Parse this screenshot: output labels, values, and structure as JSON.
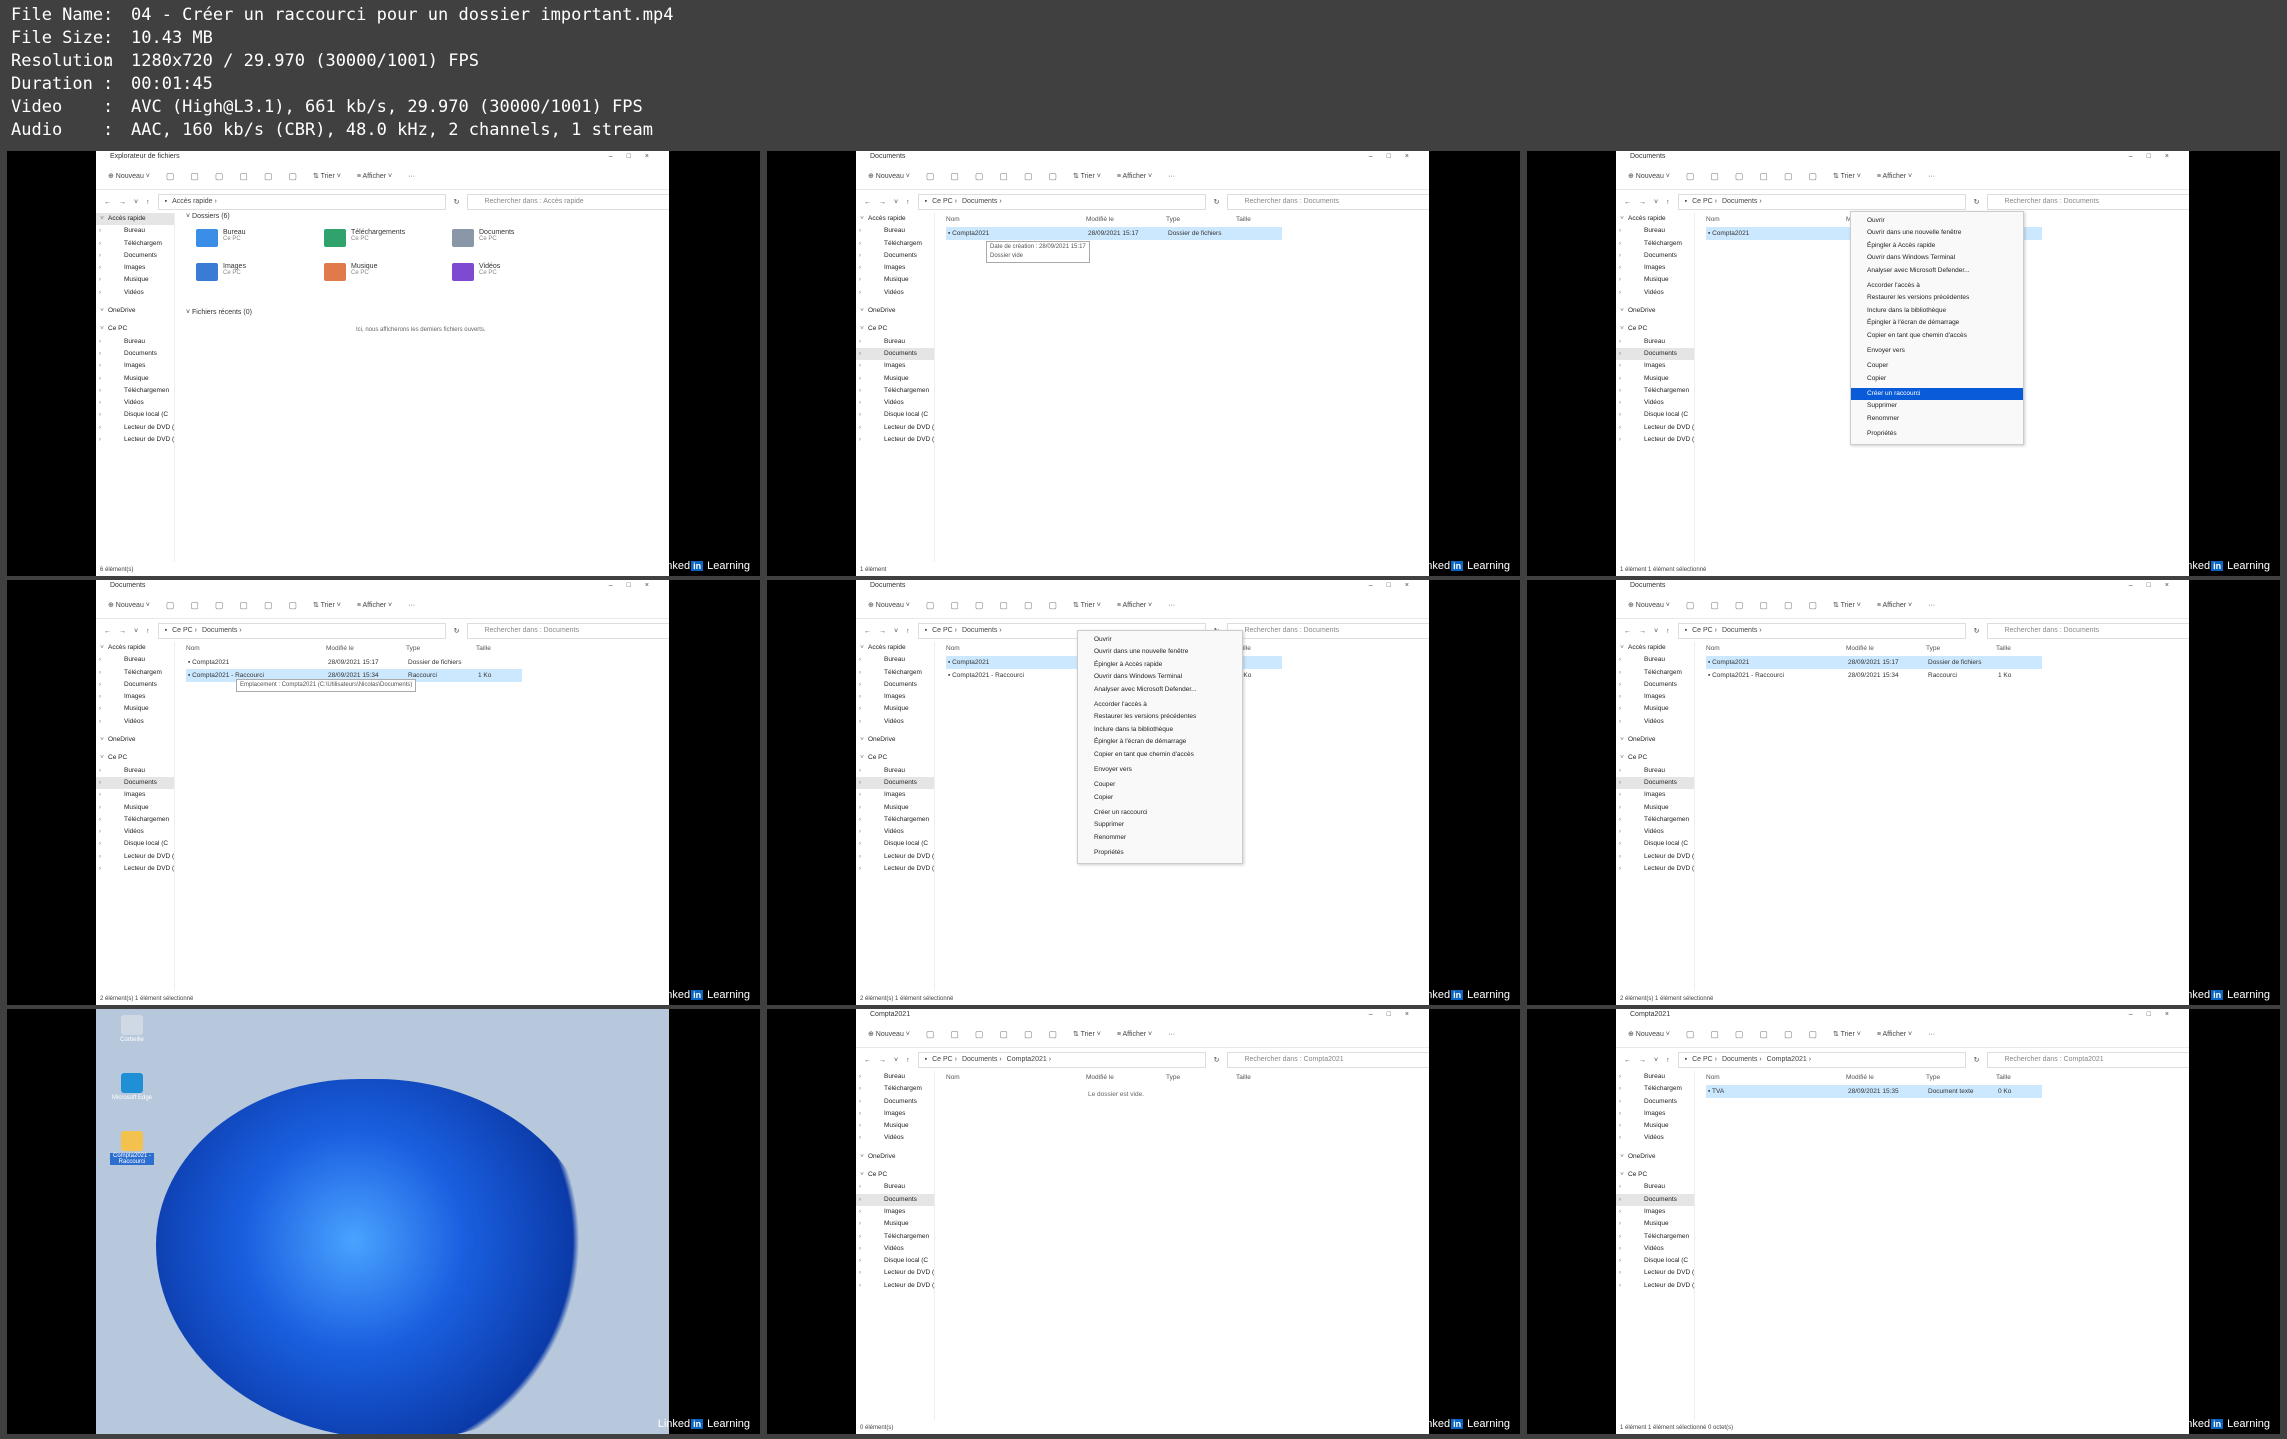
{
  "file_info": {
    "rows": [
      {
        "key": "File Name",
        "value": "04 - Créer un raccourci pour un dossier important.mp4"
      },
      {
        "key": "File Size",
        "value": "10.43 MB"
      },
      {
        "key": "Resolution",
        "value": "1280x720 / 29.970 (30000/1001) FPS"
      },
      {
        "key": "Duration",
        "value": "00:01:45"
      },
      {
        "key": "Video",
        "value": "AVC (High@L3.1), 661 kb/s, 29.970 (30000/1001) FPS"
      },
      {
        "key": "Audio",
        "value": "AAC, 160 kb/s (CBR), 48.0 kHz, 2 channels, 1 stream"
      }
    ]
  },
  "watermark": {
    "pre": "Linked",
    "badge": "in",
    "post": " Learning"
  },
  "common": {
    "nouveau": "Nouveau",
    "trier": "Trier",
    "afficher": "Afficher",
    "search_docs": "Rechercher dans : Documents",
    "search_quick": "Rechercher dans : Accès rapide",
    "search_compta": "Rechercher dans : Compta2021",
    "col_nom": "Nom",
    "col_modifie": "Modifié le",
    "col_type": "Type",
    "col_taille": "Taille"
  },
  "nav_full": [
    "Accès rapide",
    "Bureau",
    "Téléchargem",
    "Documents",
    "Images",
    "Musique",
    "Vidéos",
    "OneDrive",
    "Ce PC",
    "Bureau",
    "Documents",
    "Images",
    "Musique",
    "Téléchargemen",
    "Vidéos",
    "Disque local (C",
    "Lecteur de DVD (",
    "Lecteur de DVD ("
  ],
  "frames": [
    {
      "title": "Explorateur de fichiers",
      "path": [
        "Accès rapide"
      ],
      "search": "Rechercher dans : Accès rapide",
      "section_folders": "Dossiers (6)",
      "folders": [
        {
          "name": "Bureau",
          "sub": "Ce PC",
          "color": "#3a8ee6"
        },
        {
          "name": "Téléchargements",
          "sub": "Ce PC",
          "color": "#2fa36b"
        },
        {
          "name": "Documents",
          "sub": "Ce PC",
          "color": "#8a97a8"
        },
        {
          "name": "Images",
          "sub": "Ce PC",
          "color": "#3a7bd5"
        },
        {
          "name": "Musique",
          "sub": "Ce PC",
          "color": "#e07a4a"
        },
        {
          "name": "Vidéos",
          "sub": "Ce PC",
          "color": "#7e4ad0"
        }
      ],
      "section_recent": "Fichiers récents (0)",
      "recent_empty": "Ici, nous afficherons les derniers fichiers ouverts.",
      "status": "6 élément(s)"
    },
    {
      "title": "Documents",
      "path": [
        "Ce PC",
        "Documents"
      ],
      "rows": [
        {
          "name": "Compta2021",
          "date": "28/09/2021 15:17",
          "type": "Dossier de fichiers",
          "size": ""
        }
      ],
      "tooltip": [
        "Date de création : 28/09/2021 15:17",
        "Dossier vide"
      ],
      "status": "1 élément"
    },
    {
      "title": "Documents",
      "path": [
        "Ce PC",
        "Documents"
      ],
      "rows": [
        {
          "name": "Compta2021",
          "date": "",
          "type": "",
          "size": ""
        }
      ],
      "context": [
        "Ouvrir",
        "Ouvrir dans une nouvelle fenêtre",
        "Épingler à Accès rapide",
        "Ouvrir dans Windows Terminal",
        "Analyser avec Microsoft Defender...",
        "",
        "Accorder l'accès à",
        "Restaurer les versions précédentes",
        "Inclure dans la bibliothèque",
        "Épingler à l'écran de démarrage",
        "Copier en tant que chemin d'accès",
        "",
        "Envoyer vers",
        "",
        "Couper",
        "Copier",
        "",
        "Créer un raccourci",
        "Supprimer",
        "Renommer",
        "",
        "Propriétés"
      ],
      "highlight": "Créer un raccourci",
      "status": "1 élément    1 élément sélectionné"
    },
    {
      "title": "Documents",
      "path": [
        "Ce PC",
        "Documents"
      ],
      "rows": [
        {
          "name": "Compta2021",
          "date": "28/09/2021 15:17",
          "type": "Dossier de fichiers",
          "size": ""
        },
        {
          "name": "Compta2021 - Raccourci",
          "date": "28/09/2021 15:34",
          "type": "Raccourci",
          "size": "1 Ko"
        }
      ],
      "tooltip": [
        "Emplacement : Compta2021 (C:\\Utilisateurs\\Nicolas\\Documents)"
      ],
      "status": "2 élément(s)    1 élément sélectionné"
    },
    {
      "title": "Documents",
      "path": [
        "Ce PC",
        "Documents"
      ],
      "rows": [
        {
          "name": "Compta2021",
          "date": "",
          "type": "",
          "size": ""
        },
        {
          "name": "Compta2021 - Raccourci",
          "date": "",
          "type": "",
          "size": "1 Ko"
        }
      ],
      "context": [
        "Ouvrir",
        "Ouvrir dans une nouvelle fenêtre",
        "Épingler à Accès rapide",
        "Ouvrir dans Windows Terminal",
        "Analyser avec Microsoft Defender...",
        "",
        "Accorder l'accès à",
        "Restaurer les versions précédentes",
        "Inclure dans la bibliothèque",
        "Épingler à l'écran de démarrage",
        "Copier en tant que chemin d'accès",
        "",
        "Envoyer vers",
        "",
        "Couper",
        "Copier",
        "",
        "Créer un raccourci",
        "Supprimer",
        "Renommer",
        "",
        "Propriétés"
      ],
      "status": "2 élément(s)    1 élément sélectionné"
    },
    {
      "title": "Documents",
      "path": [
        "Ce PC",
        "Documents"
      ],
      "rows": [
        {
          "name": "Compta2021",
          "date": "28/09/2021 15:17",
          "type": "Dossier de fichiers",
          "size": ""
        },
        {
          "name": "Compta2021 - Raccourci",
          "date": "28/09/2021 15:34",
          "type": "Raccourci",
          "size": "1 Ko"
        }
      ],
      "status": "2 élément(s)    1 élément sélectionné"
    },
    {
      "desktop_icons": [
        "Corbeille",
        "Microsoft Edge",
        "Compta2021 - Raccourci"
      ]
    },
    {
      "title": "Compta2021",
      "path": [
        "Ce PC",
        "Documents",
        "Compta2021"
      ],
      "empty": "Le dossier est vide.",
      "status": "0 élément(s)"
    },
    {
      "title": "Compta2021",
      "path": [
        "Ce PC",
        "Documents",
        "Compta2021"
      ],
      "rows": [
        {
          "name": "TVA",
          "date": "28/09/2021 15:35",
          "type": "Document texte",
          "size": "0 Ko"
        }
      ],
      "status": "1 élément    1 élément sélectionné  0 octet(s)"
    }
  ],
  "colors": {
    "accent": "#0a5bd8",
    "selection": "#cce8ff",
    "linkedin": "#0a66c2"
  }
}
